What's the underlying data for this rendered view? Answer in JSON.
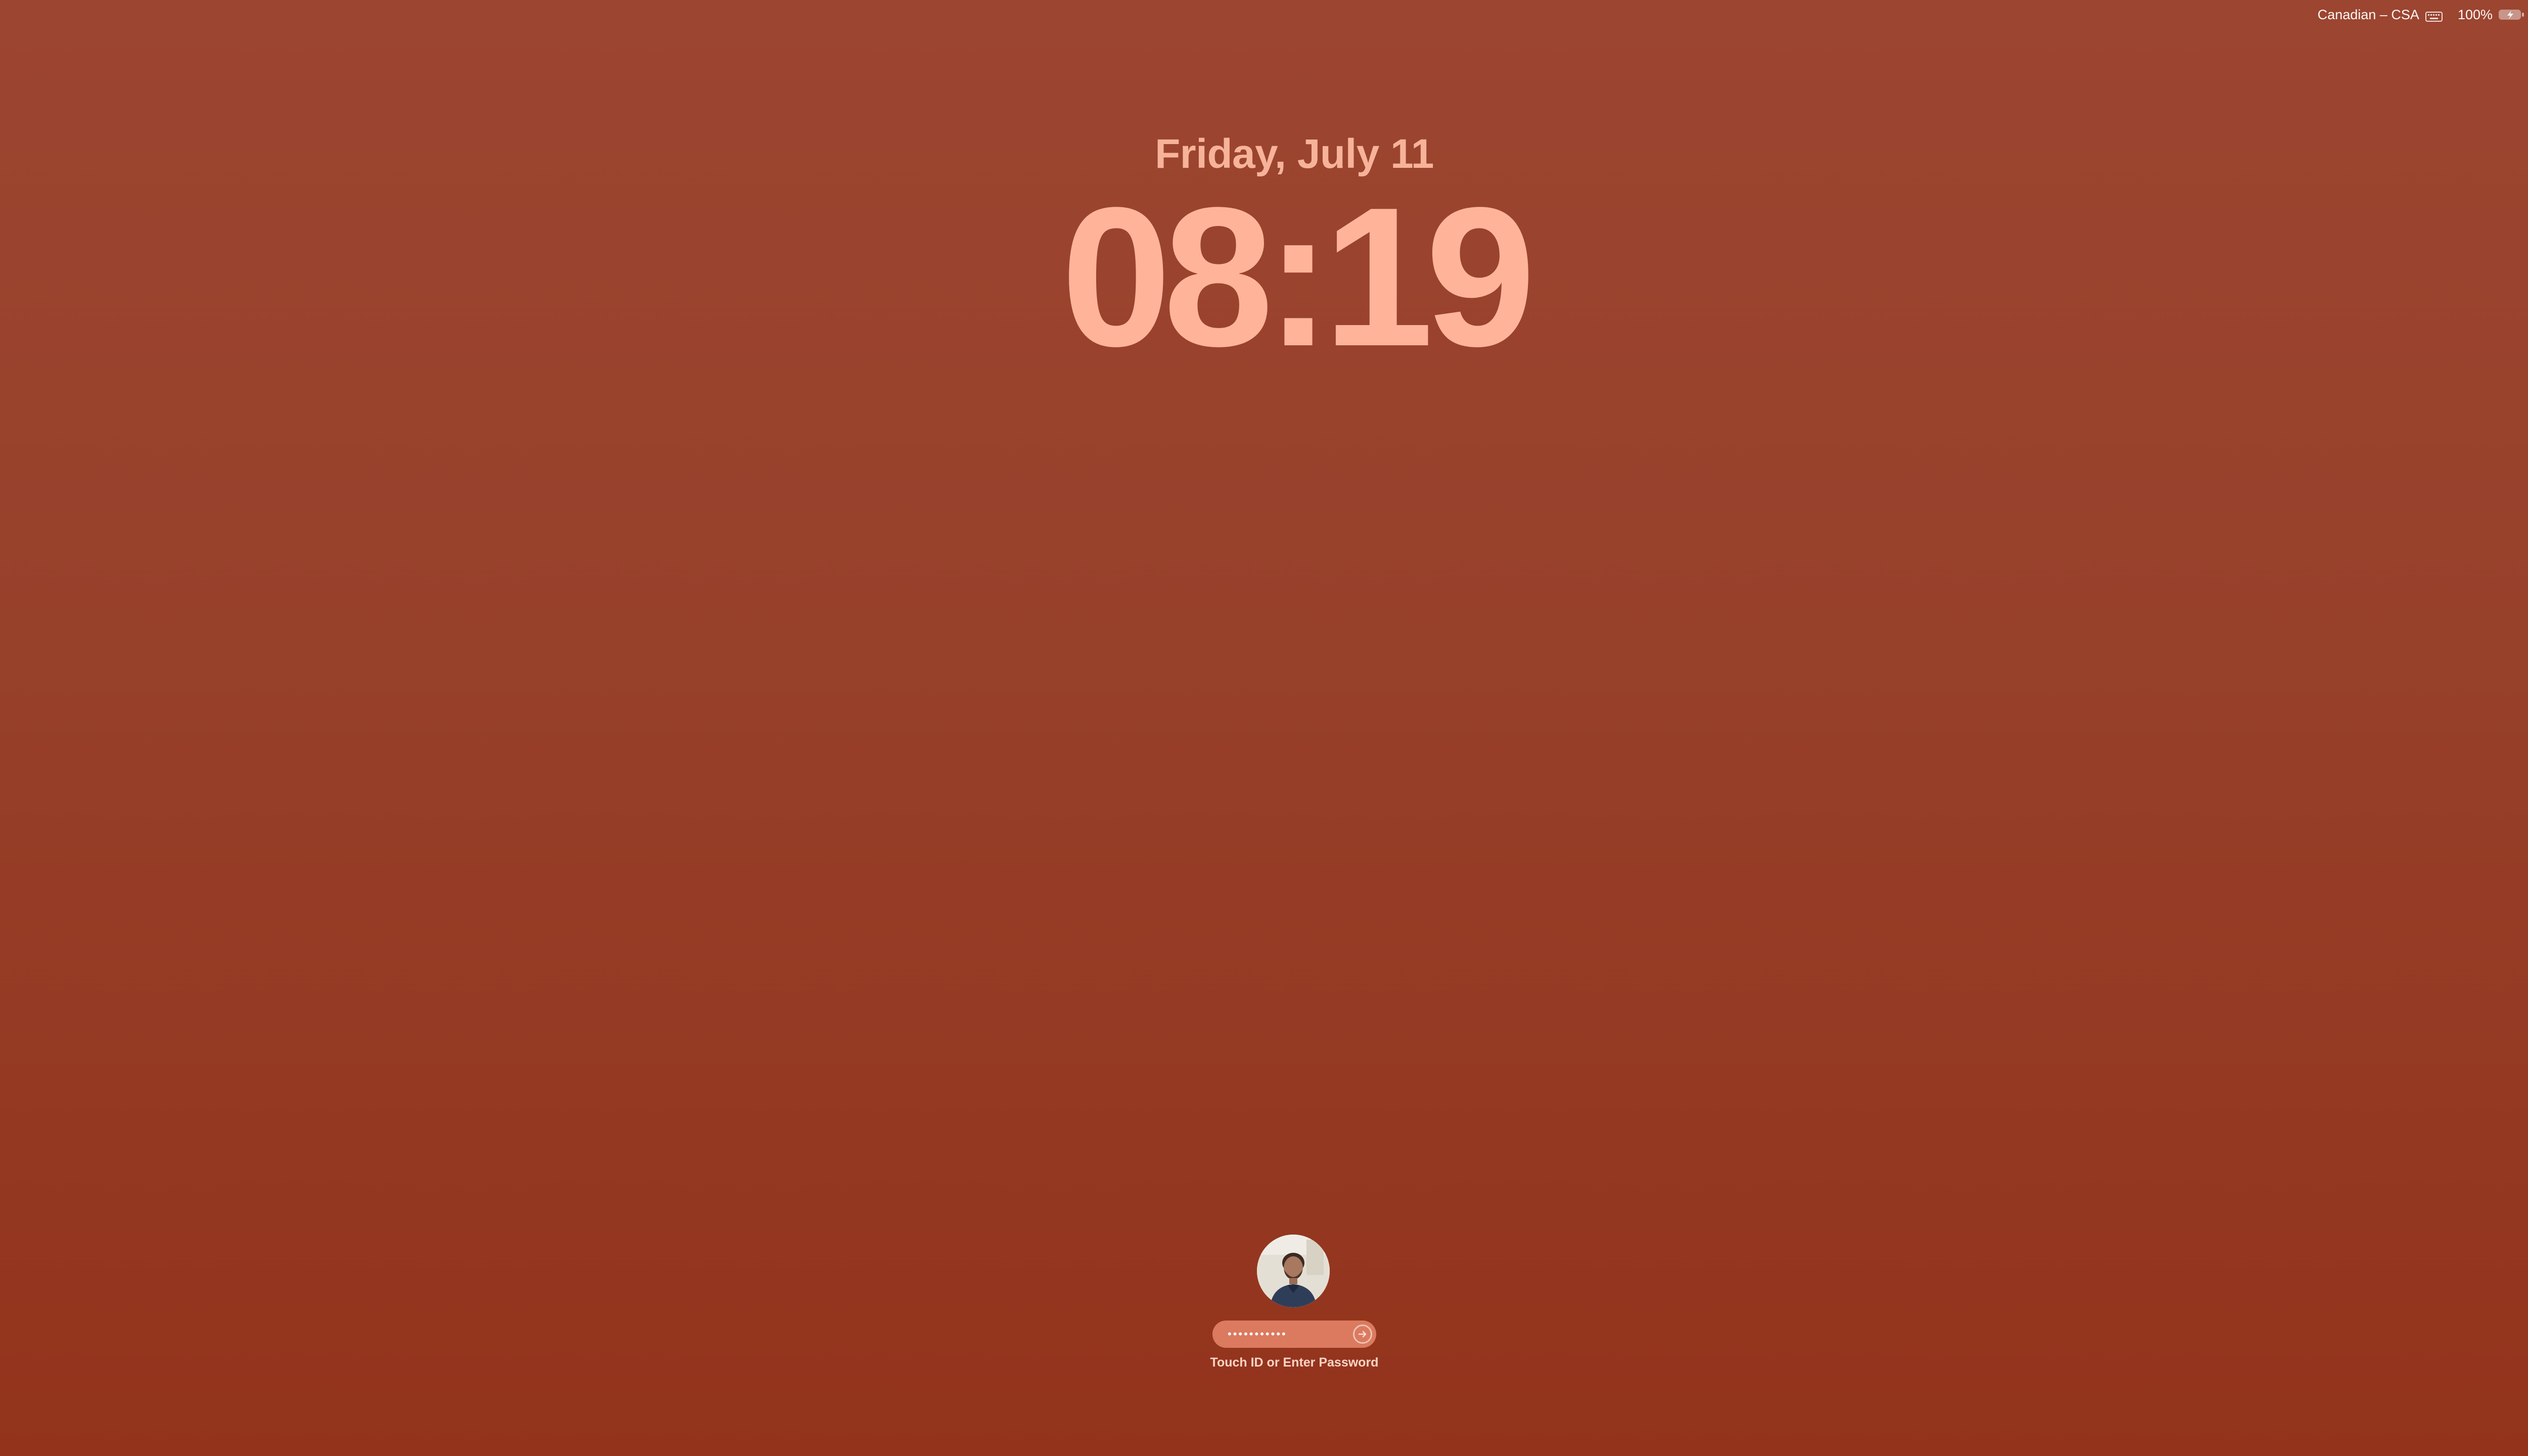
{
  "menubar": {
    "input_source": "Canadian – CSA",
    "input_source_icon": "keyboard-icon",
    "battery_percent": "100%",
    "battery_level": 1.0,
    "battery_charging": true,
    "battery_icon": "battery-charging-icon",
    "wifi_icon": "wifi-icon"
  },
  "lock_screen": {
    "date": "Friday, July 11",
    "time": "08:19",
    "text_color": "#ffb49a",
    "background_top": "#9c4530",
    "background_bottom": "#93331c"
  },
  "login": {
    "avatar_icon": "user-avatar",
    "password_masked": "•••••••••••",
    "submit_icon": "arrow-right-circle-icon",
    "hint": "Touch ID or Enter Password"
  }
}
